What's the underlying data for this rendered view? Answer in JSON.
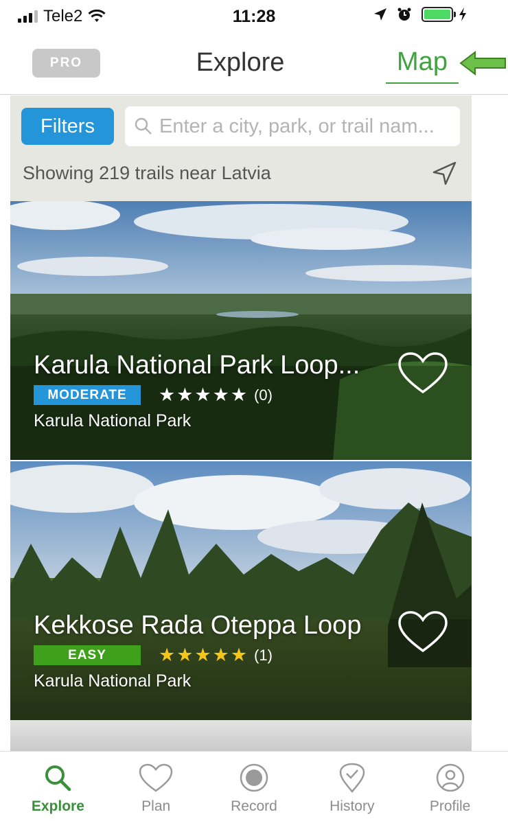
{
  "status_bar": {
    "carrier": "Tele2",
    "time": "11:28",
    "battery_color": "#4cd964"
  },
  "header": {
    "pro_label": "PRO",
    "title": "Explore",
    "map_label": "Map",
    "accent_color": "#3fa33f"
  },
  "search": {
    "filters_label": "Filters",
    "placeholder": "Enter a city, park, or trail nam...",
    "showing_text": "Showing 219 trails near Latvia",
    "filters_color": "#2595d9"
  },
  "trails": [
    {
      "name": "Karula National Park Loop...",
      "difficulty": "MODERATE",
      "difficulty_color": "#2595d9",
      "stars": "★★★★★",
      "star_color": "#ffffff",
      "rating_value": 0,
      "rating_count": "(0)",
      "park": "Karula National Park"
    },
    {
      "name": "Kekkose Rada Oteppa Loop",
      "difficulty": "EASY",
      "difficulty_color": "#3fa01c",
      "stars": "★★★★★",
      "star_color": "#f5c518",
      "rating_value": 5,
      "rating_count": "(1)",
      "park": "Karula National Park"
    }
  ],
  "tabs": [
    {
      "label": "Explore",
      "icon": "search-icon",
      "active": true
    },
    {
      "label": "Plan",
      "icon": "heart-icon",
      "active": false
    },
    {
      "label": "Record",
      "icon": "record-icon",
      "active": false
    },
    {
      "label": "History",
      "icon": "history-pin-icon",
      "active": false
    },
    {
      "label": "Profile",
      "icon": "profile-icon",
      "active": false
    }
  ]
}
